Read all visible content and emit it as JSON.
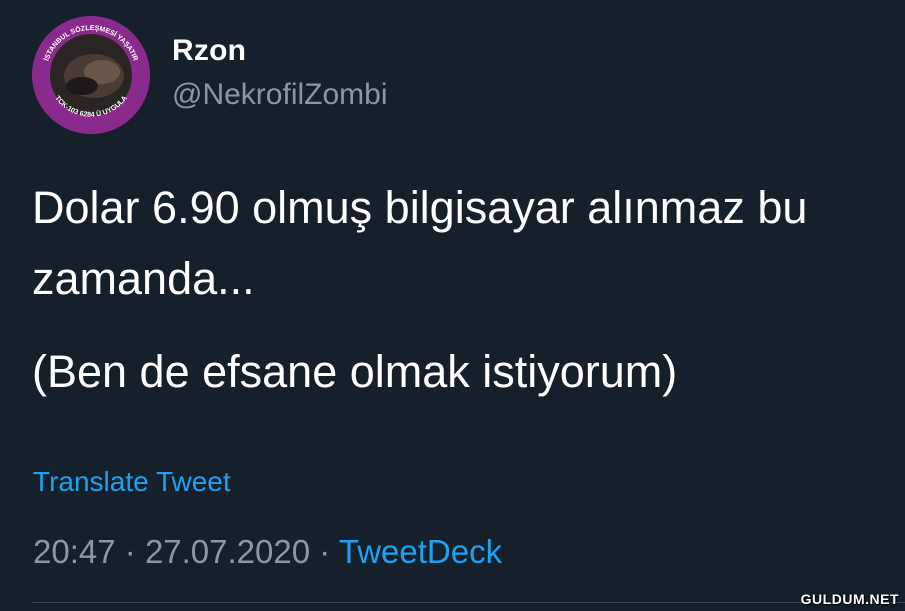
{
  "user": {
    "display_name": "Rzon",
    "handle": "@NekrofilZombi",
    "avatar_ring_text_top": "İSTANBUL SÖZLEŞMESİ YAŞATIR",
    "avatar_ring_text_bottom": "TCK-103 6284 Ü UYGULA"
  },
  "tweet": {
    "text_line_1": "Dolar 6.90 olmuş bilgisayar alınmaz bu zamanda...",
    "text_line_2": "(Ben de efsane olmak istiyorum)"
  },
  "translate_label": "Translate Tweet",
  "meta": {
    "time": "20:47",
    "separator": "·",
    "date": "27.07.2020",
    "source": "TweetDeck"
  },
  "watermark": "GULDUM.NET",
  "colors": {
    "background": "#15202b",
    "primary_text": "#ffffff",
    "secondary_text": "#8899a6",
    "accent": "#1da1f2",
    "avatar_ring": "#8a2a8c"
  }
}
